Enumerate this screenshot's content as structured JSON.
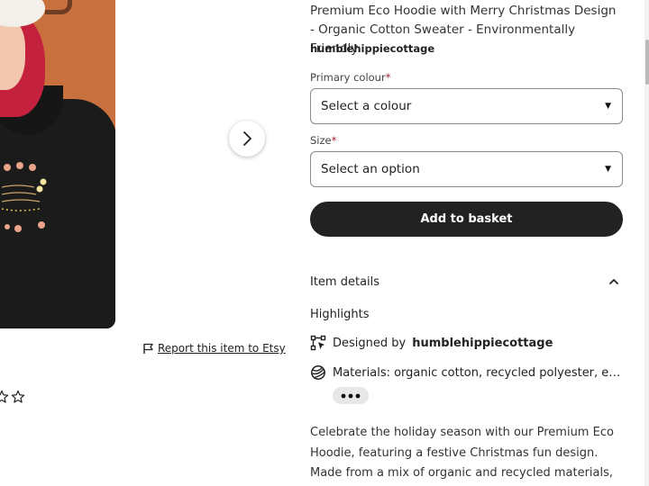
{
  "product": {
    "title": "Premium Eco Hoodie with Merry Christmas Design - Organic Cotton Sweater - Environmentally Friendly",
    "shop_name": "humblehippiecottage"
  },
  "gallery": {
    "next_icon": "chevron-right-icon"
  },
  "report": {
    "icon": "flag-icon",
    "label": "Report this item to Etsy"
  },
  "options": {
    "colour": {
      "label": "Primary colour",
      "required_mark": "*",
      "selected": "Select a colour"
    },
    "size": {
      "label": "Size",
      "required_mark": "*",
      "selected": "Select an option"
    }
  },
  "actions": {
    "add_to_basket": "Add to basket"
  },
  "item_details": {
    "heading": "Item details",
    "expanded": true,
    "highlights_heading": "Highlights",
    "designed_by_label": "Designed by",
    "designed_by_value": "humblehippiecottage",
    "materials_text": "Materials: organic cotton, recycled polyester, elastane",
    "more_icon": "more-dots-icon"
  },
  "description": "Celebrate the holiday season with our Premium Eco Hoodie, featuring a festive Christmas fun design. Made from a mix of organic and recycled materials,",
  "colors": {
    "accent_dark": "#222222",
    "required": "#a61a2e",
    "image_background": "#c8703e"
  }
}
